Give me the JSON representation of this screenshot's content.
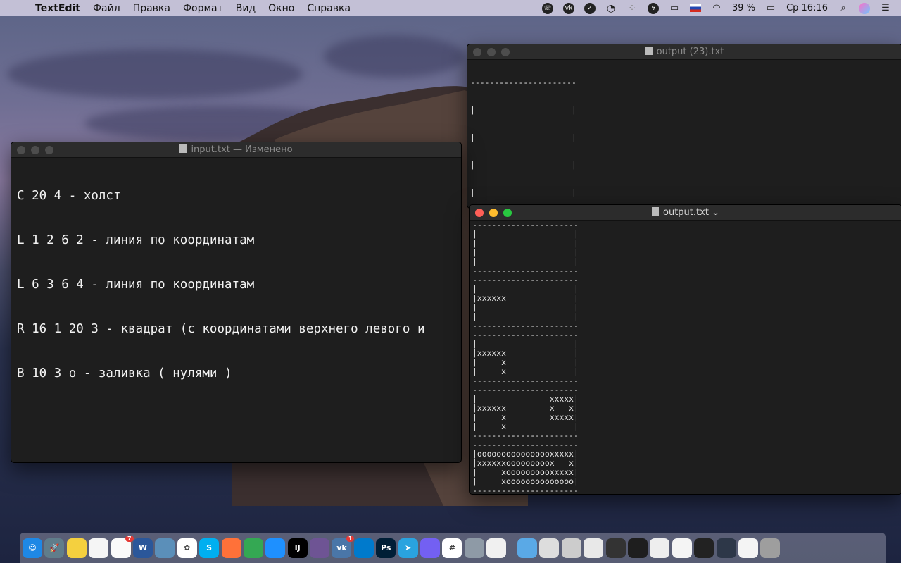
{
  "menubar": {
    "app_name": "TextEdit",
    "menus": [
      "Файл",
      "Правка",
      "Формат",
      "Вид",
      "Окно",
      "Справка"
    ],
    "battery": "39 %",
    "clock": "Ср 16:16"
  },
  "windows": {
    "input": {
      "title": "input.txt — Изменено",
      "lines": [
        "C 20 4 - холст",
        "L 1 2 6 2 - линия по координатам",
        "L 6 3 6 4 - линия по координатам",
        "R 16 1 20 3 - квадрат (с координатами верхнего левого и",
        "B 10 3 o - заливка ( нулями )"
      ]
    },
    "output23": {
      "title": "output (23).txt",
      "lines": [
        "----------------------",
        "|                    |",
        "|                    |",
        "|                    |",
        "|                    |",
        "----------------------"
      ]
    },
    "output": {
      "title": "output.txt",
      "lines": [
        "----------------------",
        "|                    |",
        "|                    |",
        "|                    |",
        "|                    |",
        "----------------------",
        "----------------------",
        "|                    |",
        "|xxxxxx              |",
        "|                    |",
        "|                    |",
        "----------------------",
        "----------------------",
        "|                    |",
        "|xxxxxx              |",
        "|     x              |",
        "|     x              |",
        "----------------------",
        "----------------------",
        "|               xxxxx|",
        "|xxxxxx         x   x|",
        "|     x         xxxxx|",
        "|     x              |",
        "----------------------",
        "----------------------",
        "|oooooooooooooooxxxxx|",
        "|xxxxxxooooooooox   x|",
        "|     xoooooooooxxxxx|",
        "|     xoooooooooooooo|",
        "----------------------"
      ]
    }
  },
  "dock": {
    "items": [
      {
        "name": "finder-icon",
        "glyph": "☺",
        "color": "#1e88e5"
      },
      {
        "name": "launchpad-icon",
        "glyph": "🚀",
        "color": "#607d8b"
      },
      {
        "name": "stickies-icon",
        "glyph": "",
        "color": "#f4d03f"
      },
      {
        "name": "notes-icon",
        "glyph": "",
        "color": "#f5f5f5"
      },
      {
        "name": "reminders-icon",
        "glyph": "",
        "color": "#fafafa",
        "badge": "7"
      },
      {
        "name": "word-icon",
        "glyph": "W",
        "color": "#2b579a"
      },
      {
        "name": "preview-icon",
        "glyph": "",
        "color": "#5b8fb9"
      },
      {
        "name": "photos-icon",
        "glyph": "✿",
        "color": "#ffffff"
      },
      {
        "name": "skype-icon",
        "glyph": "S",
        "color": "#00aff0"
      },
      {
        "name": "firefox-icon",
        "glyph": "",
        "color": "#ff7139"
      },
      {
        "name": "chrome-icon",
        "glyph": "",
        "color": "#34a853"
      },
      {
        "name": "safari-icon",
        "glyph": "",
        "color": "#1e90ff"
      },
      {
        "name": "intellij-icon",
        "glyph": "IJ",
        "color": "#000000"
      },
      {
        "name": "github-icon",
        "glyph": "",
        "color": "#6e5494"
      },
      {
        "name": "vk-icon",
        "glyph": "vk",
        "color": "#4a76a8",
        "badge": "1"
      },
      {
        "name": "vscode-icon",
        "glyph": "",
        "color": "#007acc"
      },
      {
        "name": "photoshop-icon",
        "glyph": "Ps",
        "color": "#001e36"
      },
      {
        "name": "telegram-icon",
        "glyph": "➤",
        "color": "#2aa3df"
      },
      {
        "name": "viber-icon",
        "glyph": "",
        "color": "#7360f2"
      },
      {
        "name": "slack-icon",
        "glyph": "#",
        "color": "#ffffff"
      },
      {
        "name": "image-capture-icon",
        "glyph": "",
        "color": "#8e9aa6"
      },
      {
        "name": "textedit-icon",
        "glyph": "",
        "color": "#f0f0f0"
      },
      {
        "name": "sep",
        "glyph": "",
        "color": ""
      },
      {
        "name": "folder-icon",
        "glyph": "",
        "color": "#5aa9e6"
      },
      {
        "name": "zip-file-icon",
        "glyph": "",
        "color": "#dddddd"
      },
      {
        "name": "scanner-icon",
        "glyph": "",
        "color": "#cccccc"
      },
      {
        "name": "png-file-icon",
        "glyph": "",
        "color": "#e8e8e8"
      },
      {
        "name": "window-thumb-icon",
        "glyph": "",
        "color": "#333333"
      },
      {
        "name": "window-thumb-icon",
        "glyph": "",
        "color": "#1e1e1e"
      },
      {
        "name": "window-thumb-icon",
        "glyph": "",
        "color": "#eeeeee"
      },
      {
        "name": "window-thumb-icon",
        "glyph": "",
        "color": "#f4f4f4"
      },
      {
        "name": "window-thumb-icon",
        "glyph": "",
        "color": "#222222"
      },
      {
        "name": "window-thumb-icon",
        "glyph": "",
        "color": "#2d3748"
      },
      {
        "name": "window-thumb-icon",
        "glyph": "",
        "color": "#f4f4f4"
      },
      {
        "name": "trash-icon",
        "glyph": "",
        "color": "#9e9e9e"
      }
    ]
  }
}
